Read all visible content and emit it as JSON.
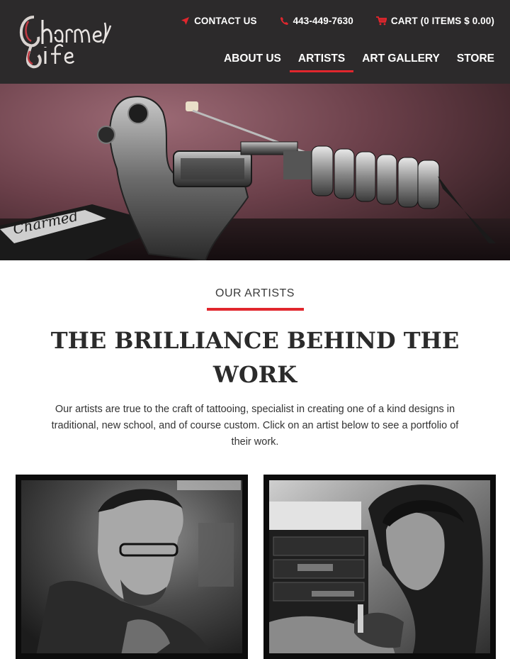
{
  "header": {
    "logo_text": "Charmed Life",
    "contact": {
      "label": "CONTACT US",
      "icon": "paper-plane-icon"
    },
    "phone": {
      "label": "443-449-7630",
      "icon": "phone-icon"
    },
    "cart": {
      "label": "CART (0 ITEMS $ 0.00)",
      "icon": "cart-icon"
    },
    "nav": [
      {
        "label": "ABOUT US",
        "active": false
      },
      {
        "label": "ARTISTS",
        "active": true
      },
      {
        "label": "ART GALLERY",
        "active": false
      },
      {
        "label": "STORE",
        "active": false
      }
    ]
  },
  "hero": {
    "subject": "tattoo machine photo"
  },
  "section": {
    "kicker": "OUR ARTISTS",
    "headline": "THE BRILLIANCE BEHIND THE WORK",
    "intro": "Our artists are true to the craft of tattooing, specialist in creating one of a kind designs in traditional, new school, and of course custom. Click on an artist below to see a portfolio of their work."
  },
  "artists": [
    {
      "subject": "artist tattooing, glasses, black and white"
    },
    {
      "subject": "artist tattooing, long hair, black and white"
    }
  ],
  "colors": {
    "header_bg": "#2c2a2b",
    "accent": "#e1262d",
    "text": "#2a2a2a"
  }
}
